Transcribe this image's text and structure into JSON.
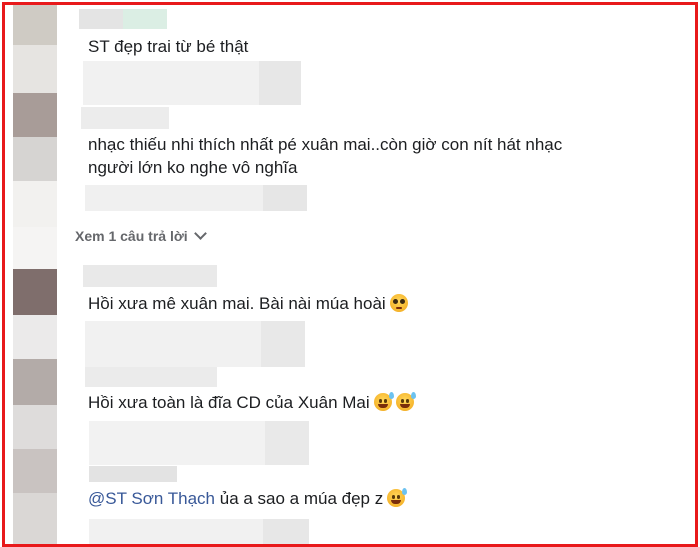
{
  "comments": [
    {
      "text": "ST đẹp trai từ bé thật"
    },
    {
      "text_line1": "nhạc thiếu nhi thích nhất pé xuân mai..còn giờ con nít hát nhạc",
      "text_line2": "người lớn ko nghe vô nghĩa"
    },
    {
      "reply_link": "Xem 1 câu trả lời"
    },
    {
      "text": "Hồi xưa mê xuân mai. Bài nài múa hoài",
      "emoji": "pleading-face-icon"
    },
    {
      "text": "Hồi xưa toàn là đĩa CD của Xuân Mai",
      "emoji": "grinning-sweat-icon"
    },
    {
      "mention": "@ST Sơn Thạch",
      "text": " ủa a sao a múa đẹp z",
      "emoji": "laughing-icon"
    }
  ],
  "colors": {
    "frame_border": "#e8191b",
    "text": "#1c1e21",
    "mention": "#385898",
    "muted": "#65676b",
    "blur_light": "#eeeeee",
    "blur_mid": "#e2e2e2"
  }
}
